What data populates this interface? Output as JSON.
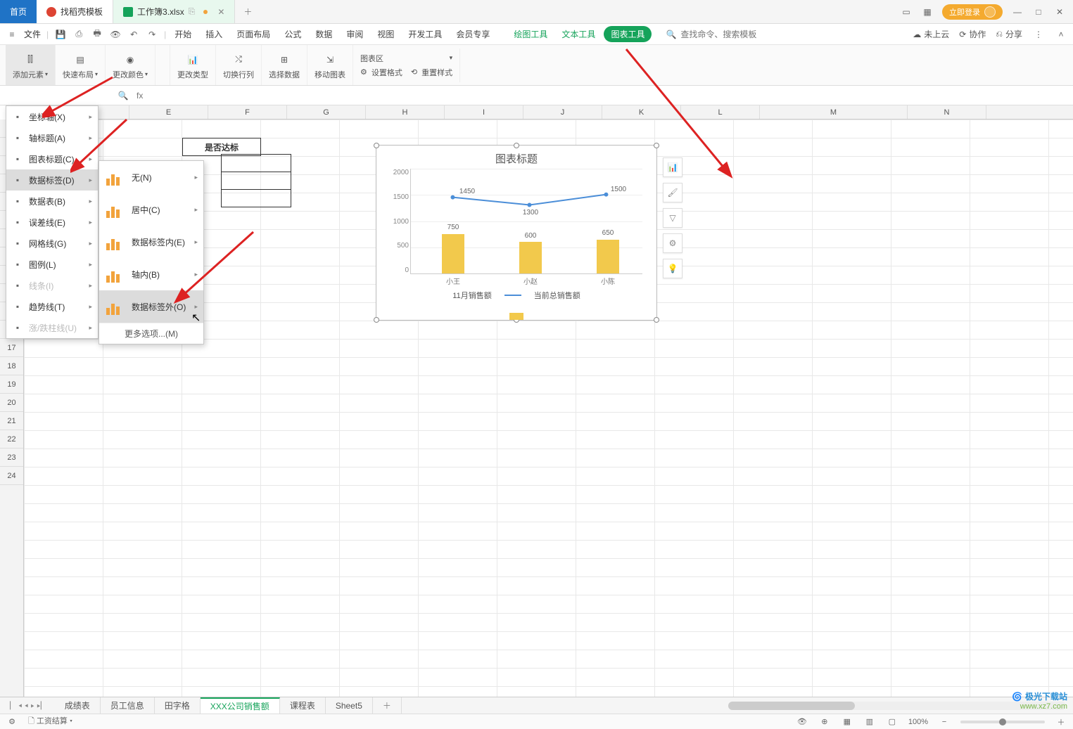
{
  "titlebar": {
    "home": "首页",
    "template": "找稻壳模板",
    "filename": "工作簿3.xlsx",
    "login": "立即登录"
  },
  "menubar": {
    "file": "文件",
    "items": [
      "开始",
      "插入",
      "页面布局",
      "公式",
      "数据",
      "审阅",
      "视图",
      "开发工具",
      "会员专享"
    ],
    "green1": "绘图工具",
    "green2": "文本工具",
    "pill": "图表工具",
    "search_placeholder": "查找命令、搜索模板",
    "cloud": "未上云",
    "coop": "协作",
    "share": "分享"
  },
  "ribbon": {
    "add_element": "添加元素",
    "quick_layout": "快速布局",
    "change_color": "更改颜色",
    "change_type": "更改类型",
    "switch_rowcol": "切换行列",
    "select_data": "选择数据",
    "move_chart": "移动图表",
    "chart_area": "图表区",
    "set_format": "设置格式",
    "reset_style": "重置样式"
  },
  "menu1": {
    "items": [
      {
        "label": "坐标轴(X)",
        "disabled": false
      },
      {
        "label": "轴标题(A)",
        "disabled": false
      },
      {
        "label": "图表标题(C)",
        "disabled": false
      },
      {
        "label": "数据标签(D)",
        "disabled": false,
        "highlight": true
      },
      {
        "label": "数据表(B)",
        "disabled": false
      },
      {
        "label": "误差线(E)",
        "disabled": false
      },
      {
        "label": "网格线(G)",
        "disabled": false
      },
      {
        "label": "图例(L)",
        "disabled": false
      },
      {
        "label": "线条(I)",
        "disabled": true
      },
      {
        "label": "趋势线(T)",
        "disabled": false
      },
      {
        "label": "涨/跌柱线(U)",
        "disabled": true
      }
    ]
  },
  "menu2": {
    "items": [
      {
        "label": "无(N)"
      },
      {
        "label": "居中(C)"
      },
      {
        "label": "数据标签内(E)"
      },
      {
        "label": "轴内(B)"
      },
      {
        "label": "数据标签外(O)",
        "highlight": true
      }
    ],
    "more": "更多选项...(M)"
  },
  "columns": [
    "E",
    "F",
    "G",
    "H",
    "I",
    "J",
    "K",
    "L",
    "M",
    "N"
  ],
  "cell_e5": "是否达标",
  "chart": {
    "title": "图表标题",
    "legend_bar": "11月销售额",
    "legend_line": "当前总销售额"
  },
  "chart_data": {
    "type": "bar+line",
    "categories": [
      "小王",
      "小赵",
      "小陈"
    ],
    "series": [
      {
        "name": "11月销售额",
        "type": "bar",
        "values": [
          750,
          600,
          650
        ]
      },
      {
        "name": "当前总销售额",
        "type": "line",
        "values": [
          1450,
          1300,
          1500
        ]
      }
    ],
    "ylim": [
      0,
      2000
    ],
    "yticks": [
      0,
      500,
      1000,
      1500,
      2000
    ],
    "bar_labels": [
      750,
      600,
      650
    ],
    "line_labels": [
      1450,
      1300,
      1500
    ]
  },
  "sheets": {
    "tabs": [
      "成绩表",
      "员工信息",
      "田字格",
      "XXX公司销售额",
      "课程表",
      "Sheet5"
    ],
    "active": "XXX公司销售额"
  },
  "statusbar": {
    "calc": "工资结算",
    "zoom": "100%"
  },
  "watermark": {
    "l1": "极光下载站",
    "l2": "www.xz7.com"
  }
}
